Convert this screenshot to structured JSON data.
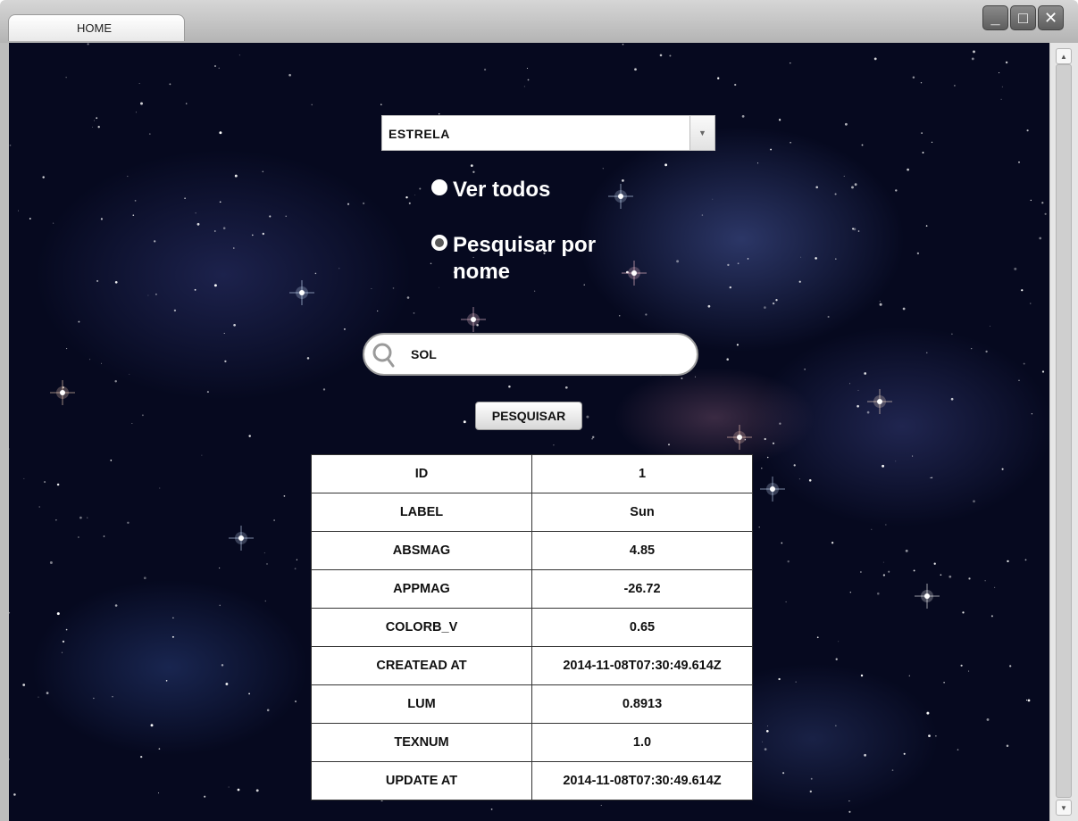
{
  "window": {
    "tab_label": "HOME",
    "controls": {
      "minimize": "_",
      "maximize": "□",
      "close": "✕"
    }
  },
  "form": {
    "category_select": {
      "selected": "ESTRELA",
      "arrow_icon": "▼"
    },
    "radios": [
      {
        "label": "Ver todos",
        "checked": false
      },
      {
        "label": "Pesquisar por nome",
        "checked": true
      }
    ],
    "search": {
      "value": "SOL",
      "icon": "search-icon"
    },
    "search_button": "PESQUISAR"
  },
  "results": {
    "rows": [
      {
        "field": "ID",
        "value": "1"
      },
      {
        "field": "LABEL",
        "value": "Sun"
      },
      {
        "field": "ABSMAG",
        "value": "4.85"
      },
      {
        "field": "APPMAG",
        "value": "-26.72"
      },
      {
        "field": "COLORB_V",
        "value": "0.65"
      },
      {
        "field": "CREATEAD AT",
        "value": "2014-11-08T07:30:49.614Z"
      },
      {
        "field": "LUM",
        "value": "0.8913"
      },
      {
        "field": "TEXNUM",
        "value": "1.0"
      },
      {
        "field": "UPDATE AT",
        "value": "2014-11-08T07:30:49.614Z"
      }
    ]
  },
  "scrollbar": {
    "up_icon": "▲",
    "down_icon": "▼"
  },
  "colors": {
    "background": "#06091f",
    "text_light": "#ffffff",
    "text_dark": "#111111"
  }
}
